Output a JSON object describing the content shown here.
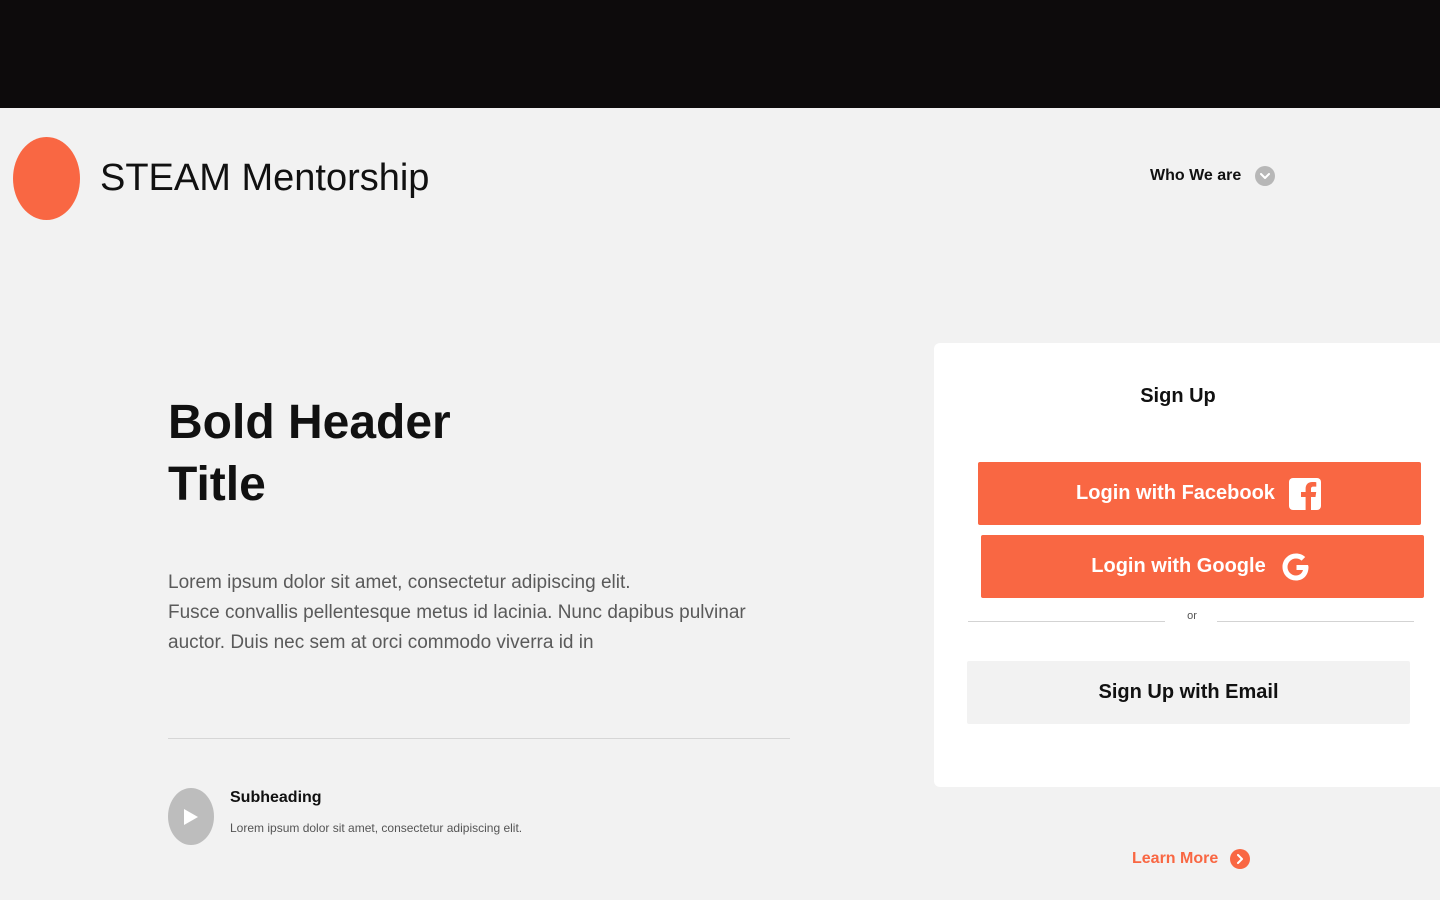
{
  "brand": {
    "name": "STEAM Mentorship"
  },
  "nav": {
    "who_we_are": "Who We are",
    "who_we_are_icon": "chevron-down-icon"
  },
  "hero": {
    "title_line1": "Bold Header",
    "title_line2": "Title",
    "body_line1": "Lorem ipsum dolor sit amet, consectetur adipiscing elit.",
    "body_line2": "Fusce convallis pellentesque metus id lacinia. Nunc dapibus pulvinar",
    "body_line3": "auctor. Duis nec sem at orci commodo viverra id in"
  },
  "feature": {
    "icon": "play-icon",
    "subheading": "Subheading",
    "text": "Lorem ipsum dolor sit amet, consectetur adipiscing elit."
  },
  "signup": {
    "title": "Sign Up",
    "facebook_label": "Login with Facebook",
    "facebook_icon": "facebook-icon",
    "google_label": "Login with Google",
    "google_icon": "google-icon",
    "or_label": "or",
    "email_label": "Sign Up with Email"
  },
  "learn_more": {
    "label": "Learn More",
    "icon": "chevron-right-icon"
  },
  "colors": {
    "accent": "#f96743",
    "topbar": "#0d0b0c",
    "background": "#f2f2f2",
    "card": "#ffffff"
  }
}
